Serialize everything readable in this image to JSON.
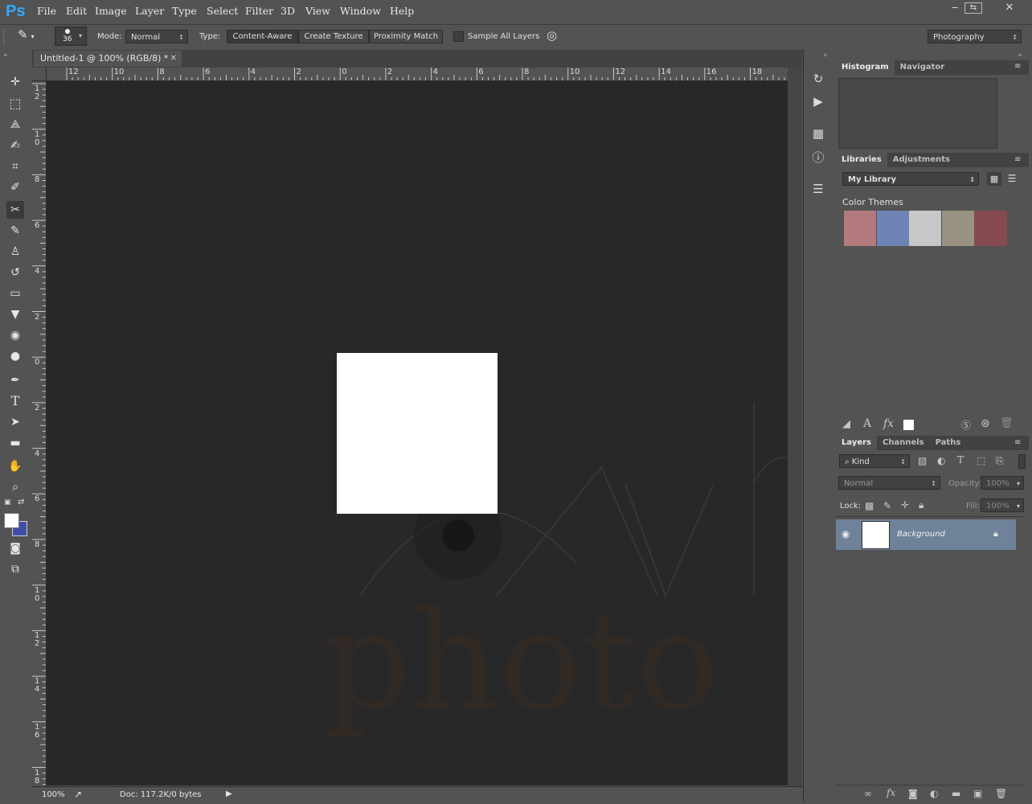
{
  "app": {
    "logo": "Ps"
  },
  "menu": [
    "File",
    "Edit",
    "Image",
    "Layer",
    "Type",
    "Select",
    "Filter",
    "3D",
    "View",
    "Window",
    "Help"
  ],
  "window_controls": {
    "minimize": "‒",
    "restore": "⇆",
    "close": "✕"
  },
  "options_bar": {
    "brush_size": "36",
    "mode_label": "Mode:",
    "mode_value": "Normal",
    "type_label": "Type:",
    "type_options": [
      "Content-Aware",
      "Create Texture",
      "Proximity Match"
    ],
    "type_selected": "Content-Aware",
    "sample_all_label": "Sample All Layers",
    "sample_all_checked": false,
    "workspace": "Photography"
  },
  "document": {
    "tab_title": "Untitled-1 @ 100% (RGB/8) *",
    "canvas_color": "#ffffff",
    "zoom": "100%",
    "doc_info": "Doc: 117.2K/0 bytes"
  },
  "rulers": {
    "horizontal": [
      "12",
      "10",
      "8",
      "6",
      "4",
      "2",
      "0",
      "2",
      "4",
      "6",
      "8",
      "10",
      "12",
      "14",
      "16",
      "18"
    ],
    "vertical": [
      "1\n2",
      "1\n0",
      "8",
      "6",
      "4",
      "2",
      "0",
      "2",
      "4",
      "6",
      "8",
      "1\n0",
      "1\n2",
      "1\n4",
      "1\n6",
      "1\n8"
    ]
  },
  "tools": [
    "move-tool",
    "rectangular-marquee-tool",
    "lasso-tool",
    "quick-selection-tool",
    "crop-tool",
    "eyedropper-tool",
    "spot-healing-brush-tool",
    "brush-tool",
    "clone-stamp-tool",
    "history-brush-tool",
    "eraser-tool",
    "paint-bucket-tool",
    "blur-tool",
    "dodge-tool",
    "pen-tool",
    "type-tool",
    "path-selection-tool",
    "rectangle-tool",
    "hand-tool",
    "zoom-tool"
  ],
  "active_tool": "spot-healing-brush-tool",
  "colors": {
    "foreground": "#ffffff",
    "background": "#3f4fa8"
  },
  "panels": {
    "histogram_tabs": [
      "Histogram",
      "Navigator"
    ],
    "libraries_tabs": [
      "Libraries",
      "Adjustments"
    ],
    "library_select": "My Library",
    "color_themes_label": "Color Themes",
    "color_themes": [
      "#b27a7c",
      "#6d84b4",
      "#c7c7c7",
      "#9a9282",
      "#844a50"
    ],
    "layers_tabs": [
      "Layers",
      "Channels",
      "Paths"
    ],
    "filter_kind": "Kind",
    "blend_mode": "Normal",
    "opacity_label": "Opacity:",
    "opacity_value": "100%",
    "lock_label": "Lock:",
    "fill_label": "Fill:",
    "fill_value": "100%",
    "layers": [
      {
        "name": "Background",
        "visible": true,
        "locked": true
      }
    ]
  }
}
